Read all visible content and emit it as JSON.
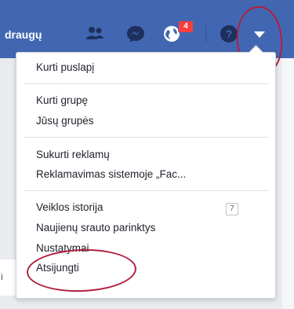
{
  "topbar": {
    "user_text": "draugų",
    "notifications_count": "4",
    "colors": {
      "bar": "#4267b2",
      "badge": "#fa3e3e"
    }
  },
  "icons": {
    "friends": "friends-icon",
    "messenger": "messenger-icon",
    "notifications": "globe-icon",
    "help": "help-icon",
    "menu": "dropdown-caret-icon"
  },
  "menu": {
    "create_page": "Kurti puslapį",
    "create_group": "Kurti grupę",
    "your_groups": "Jūsų grupės",
    "create_ad": "Sukurti reklamų",
    "advertising": "Reklamavimas sistemoje „Fac...",
    "activity_log": "Veiklos istorija",
    "activity_count": "7",
    "news_feed_prefs": "Naujienų srauto parinktys",
    "settings": "Nustatymai",
    "logout": "Atsijungti"
  },
  "background": {
    "left_fragment": "i"
  }
}
